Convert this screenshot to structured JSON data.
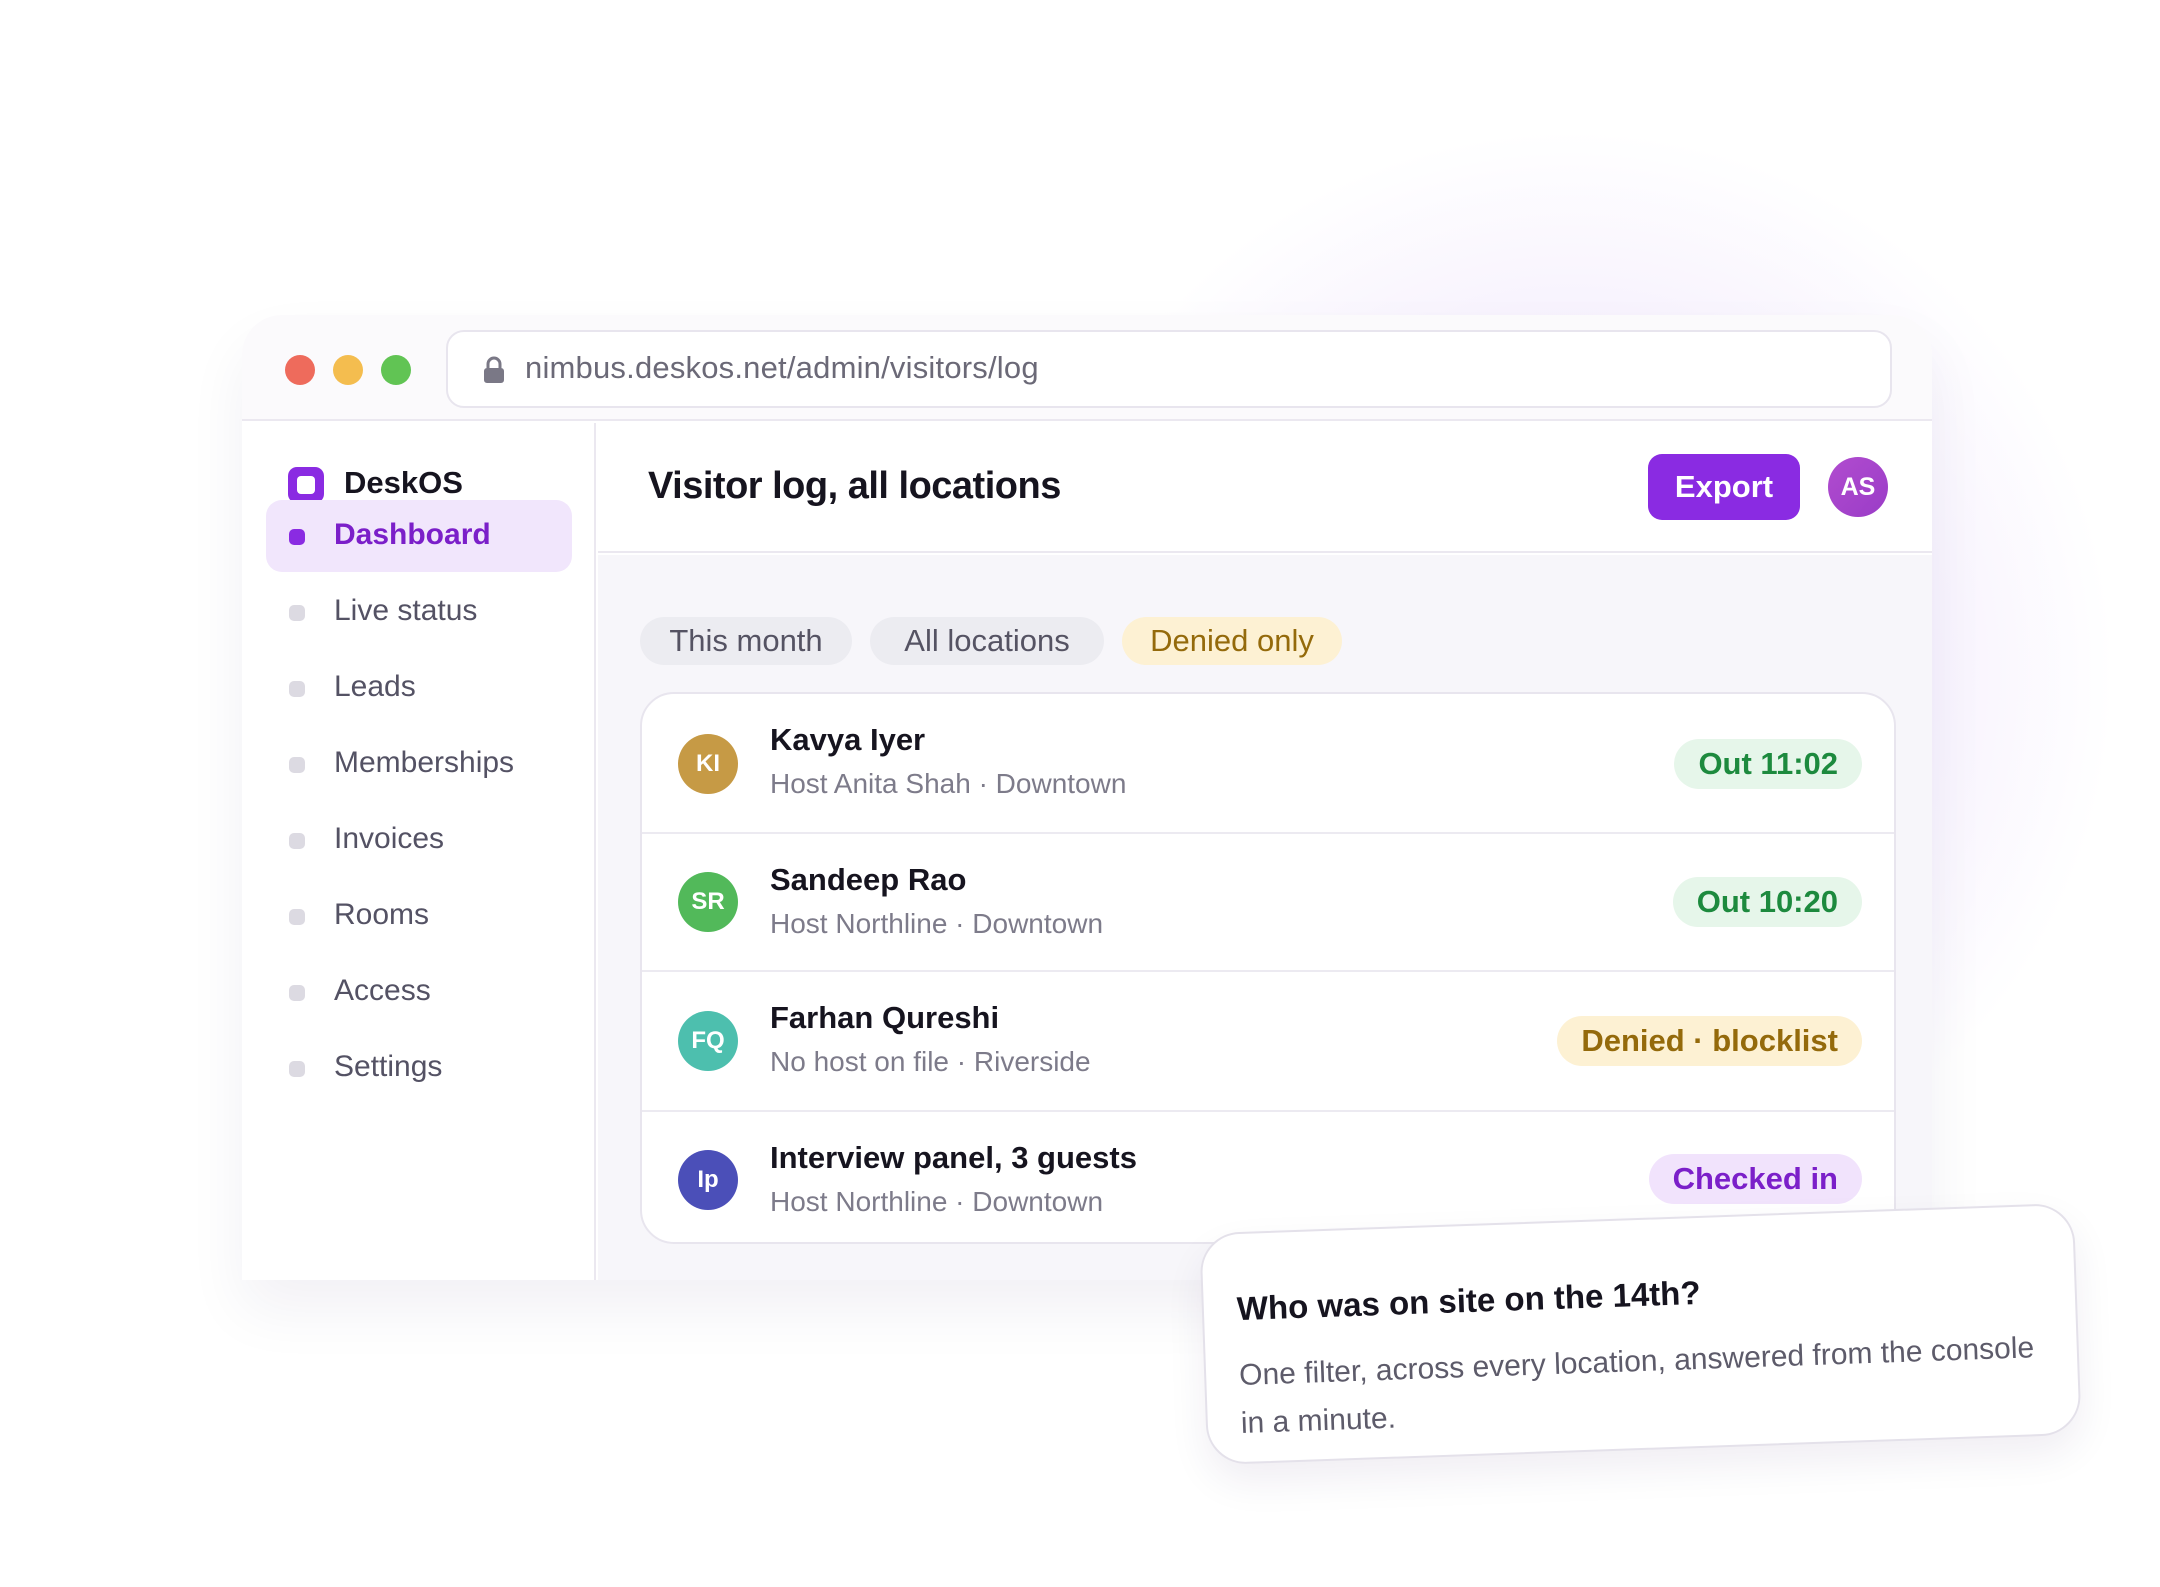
{
  "browser": {
    "url": "nimbus.deskos.net/admin/visitors/log"
  },
  "sidebar": {
    "brand": "DeskOS",
    "items": [
      {
        "label": "Dashboard"
      },
      {
        "label": "Live status"
      },
      {
        "label": "Leads"
      },
      {
        "label": "Memberships"
      },
      {
        "label": "Invoices"
      },
      {
        "label": "Rooms"
      },
      {
        "label": "Access"
      },
      {
        "label": "Settings"
      }
    ]
  },
  "header": {
    "title": "Visitor log, all locations",
    "export_label": "Export",
    "user_initials": "AS"
  },
  "filters": [
    {
      "label": "This month"
    },
    {
      "label": "All locations"
    },
    {
      "label": "Denied only"
    }
  ],
  "visitors": [
    {
      "initials": "KI",
      "name": "Kavya Iyer",
      "sub": "Host Anita Shah · Downtown",
      "status": "Out 11:02",
      "avatar_color": "#c69a45"
    },
    {
      "initials": "SR",
      "name": "Sandeep Rao",
      "sub": "Host Northline · Downtown",
      "status": "Out 10:20",
      "avatar_color": "#52b95a"
    },
    {
      "initials": "FQ",
      "name": "Farhan Qureshi",
      "sub": "No host on file · Riverside",
      "status": "Denied · blocklist",
      "avatar_color": "#4dbfae"
    },
    {
      "initials": "Ip",
      "name": "Interview panel, 3 guests",
      "sub": "Host Northline · Downtown",
      "status": "Checked in",
      "avatar_color": "#4b4fb8"
    }
  ],
  "callout": {
    "title": "Who was on site on the 14th?",
    "body": "One filter, across every location, answered from the console in a minute."
  },
  "colors": {
    "accent": "#8a2be2",
    "status_out": "#1d8a3e",
    "status_denied": "#946a0b",
    "status_checked_in": "#7b1fc9"
  },
  "icons": [
    "lock-icon",
    "brand-logo-icon"
  ]
}
